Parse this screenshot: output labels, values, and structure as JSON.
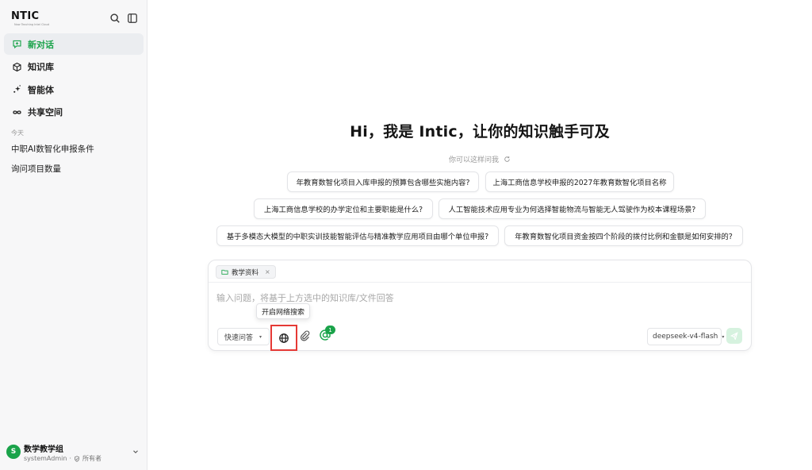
{
  "brand": {
    "name": "NTIC",
    "tagline": "Now Teaching Intel Cloud"
  },
  "icons": {
    "search": "search-icon",
    "sidebar_toggle": "sidebar-toggle-icon",
    "new_chat": "chat-plus-icon",
    "knowledge": "cube-icon",
    "agent": "sparkle-icon",
    "shared": "infinity-icon",
    "refresh": "refresh-icon",
    "folder": "folder-icon",
    "globe": "globe-icon",
    "paperclip": "paperclip-icon",
    "agent_at": "at-agent-icon",
    "send": "send-icon",
    "owner": "shield-icon",
    "chevron": "chevron-down-icon"
  },
  "colors": {
    "accent": "#1aa34a",
    "highlight_box": "#e53935"
  },
  "nav": {
    "items": [
      {
        "label": "新对话",
        "active": true
      },
      {
        "label": "知识库"
      },
      {
        "label": "智能体"
      },
      {
        "label": "共享空间"
      }
    ]
  },
  "history": {
    "section_label": "今天",
    "items": [
      "中职AI数智化申报条件",
      "询问项目数量"
    ]
  },
  "user": {
    "avatar_letter": "S",
    "name": "数学教学组",
    "account": "systemAdmin",
    "separator": "·",
    "role": "所有者"
  },
  "main": {
    "title": "Hi，我是 Intic，让你的知识触手可及",
    "subtitle": "你可以这样问我",
    "suggestions": [
      "年教育数智化项目入库申报的预算包含哪些实施内容?",
      "上海工商信息学校申报的2027年教育数智化项目名称",
      "上海工商信息学校的办学定位和主要职能是什么?",
      "人工智能技术应用专业为何选择智能物流与智能无人驾驶作为校本课程场景?",
      "基于多模态大模型的中职实训技能智能评估与精准教学应用项目由哪个单位申报?",
      "年教育数智化项目资金按四个阶段的拨付比例和金额是如何安排的?"
    ]
  },
  "composer": {
    "kb_tag": "教学资料",
    "kb_tag_close": "×",
    "placeholder": "输入问题，将基于上方选中的知识库/文件回答",
    "value": "",
    "tooltip": "开启网络搜索",
    "mode": "快速问答",
    "agent_badge": "1",
    "model": "deepseek-v4-flash",
    "caret": "▾"
  }
}
